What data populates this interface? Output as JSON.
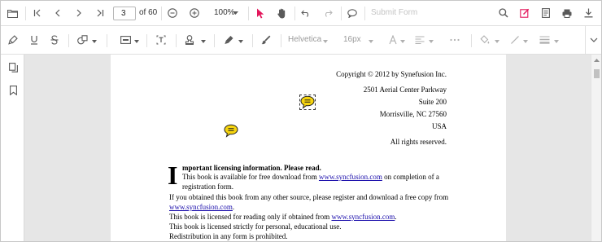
{
  "toolbar": {
    "current_page": "3",
    "page_total": "of 60",
    "zoom": "100%",
    "submit_label": "Submit Form",
    "font_family": "Helvetica",
    "font_size": "16px"
  },
  "document": {
    "address": [
      "Copyright © 2012 by Synefusion Inc.",
      "2501 Aerial Center Parkway",
      "Suite 200",
      "Morrisville, NC 27560",
      "USA"
    ],
    "rights": "All rights reserved.",
    "dropcap": "I",
    "heading": "mportant licensing information. Please read.",
    "p1_pre": "This book is available for free download from ",
    "p1_link": "www.syncfusion.com",
    "p1_post": " on completion of a",
    "p2": "registration form.",
    "p3": "If you obtained this book from any other source, please register and download a free copy from",
    "p4_link": "www.syncfusion.com",
    "p4_post": ".",
    "p5_pre": "This book is licensed for reading only if obtained from ",
    "p5_link": "www.syncfusion.com",
    "p5_post": ".",
    "p6": "This book is licensed strictly for personal, educational use.",
    "p7": "Redistribution in any form is prohibited."
  },
  "colors": {
    "accent": "#e3165b",
    "note_fill": "#f6d40f",
    "link": "#1a0dab"
  },
  "icons": {
    "top": [
      "open-file",
      "first-page",
      "previous-page",
      "next-page",
      "last-page",
      "zoom-out",
      "zoom-in",
      "select-pointer",
      "pan-hand",
      "undo",
      "redo",
      "comment",
      "search",
      "edit-annotation",
      "form-designer",
      "print",
      "download"
    ],
    "annotation": [
      "highlight",
      "underline",
      "strikethrough",
      "shapes",
      "calibrate",
      "free-text",
      "stamp",
      "signature",
      "ink",
      "font-color",
      "text-align",
      "more-options",
      "fill-color",
      "stroke-color",
      "thickness",
      "collapse"
    ],
    "sidebar": [
      "page-thumbnails",
      "bookmarks"
    ]
  }
}
